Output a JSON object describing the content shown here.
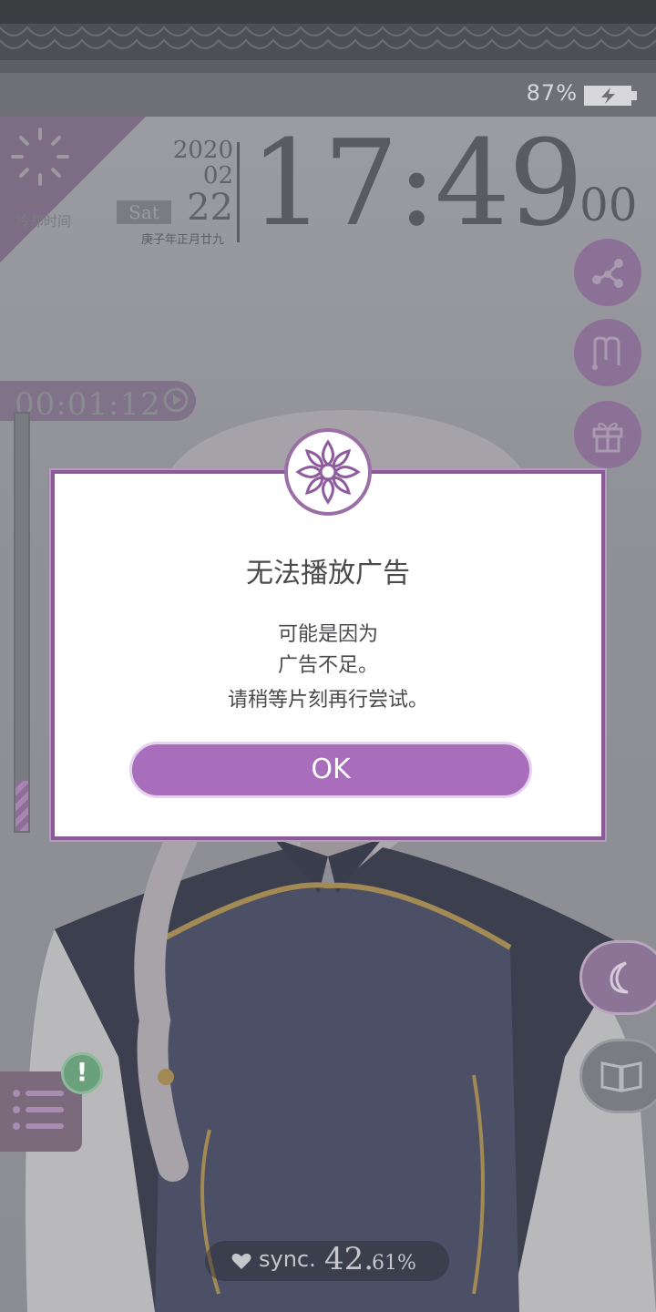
{
  "status_bar": {
    "battery_percent": "87%",
    "charging": true
  },
  "cooldown": {
    "label": "冷却时间"
  },
  "date": {
    "year": "2020",
    "month": "02",
    "day": "22",
    "weekday": "Sat",
    "lunar": "庚子年正月廿九"
  },
  "clock": {
    "hh_mm": "17:49",
    "seconds": "00"
  },
  "timer": {
    "value": "00:01:12",
    "gauge_fill_fraction": 0.12
  },
  "right_buttons": [
    "share-icon",
    "m-icon",
    "gift-icon"
  ],
  "dialog": {
    "title": "无法播放广告",
    "line1": "可能是因为",
    "line2": "广告不足。",
    "line3": "请稍等片刻再行尝试。",
    "ok_label": "OK"
  },
  "side_buttons": [
    "moon-icon",
    "book-icon"
  ],
  "menu": {
    "alert_mark": "!"
  },
  "sync": {
    "label": "sync.",
    "value_major": "42.",
    "value_minor": "61%"
  },
  "colors": {
    "accent": "#a86dbb",
    "dialog_border": "#8d5a99",
    "alert": "#6aa07c"
  }
}
